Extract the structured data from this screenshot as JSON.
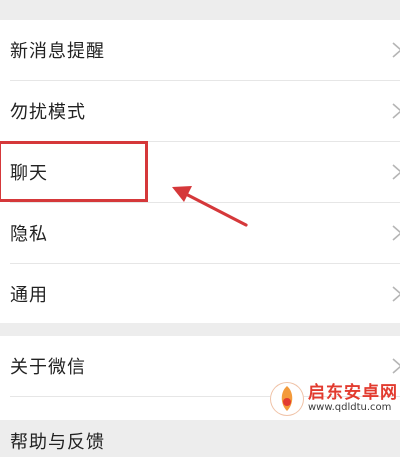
{
  "settings": {
    "items": [
      {
        "label": "新消息提醒"
      },
      {
        "label": "勿扰模式"
      },
      {
        "label": "聊天"
      },
      {
        "label": "隐私"
      },
      {
        "label": "通用"
      }
    ],
    "items2": [
      {
        "label": "关于微信"
      },
      {
        "label": "帮助与反馈"
      }
    ]
  },
  "annotation": {
    "highlight_color": "#d5383a",
    "arrow_color": "#d5383a",
    "target_item": "聊天"
  },
  "watermark": {
    "title": "启东安卓网",
    "url": "www.qdldtu.com"
  }
}
